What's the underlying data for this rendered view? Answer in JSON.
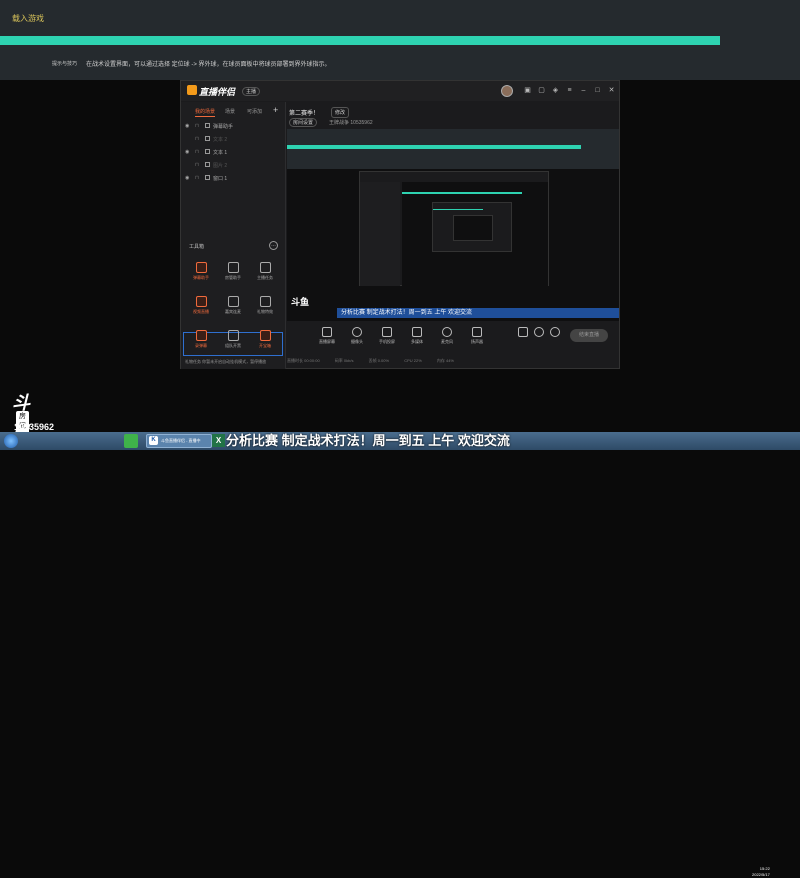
{
  "game": {
    "title": "载入游戏",
    "progress": 0.9,
    "tip_label": "提示与技巧",
    "tip_text": "在战术设置界面，可以通过选择 定位球 -> 界外球，在球员面板中将球员部署到界外球指示。"
  },
  "app": {
    "logo_text": "直播伴侣",
    "badge": "主播",
    "tabs": [
      "我的场景",
      "场景",
      "可添加"
    ],
    "sources": [
      {
        "name": "弹幕助手",
        "dim": false
      },
      {
        "name": "文本 2",
        "dim": true
      },
      {
        "name": "文本 1",
        "dim": false
      },
      {
        "name": "图片 2",
        "dim": true
      },
      {
        "name": "窗口 1",
        "dim": false
      }
    ],
    "tools_label": "工具箱",
    "tools": [
      {
        "label": "弹幕助手",
        "hot": true
      },
      {
        "label": "房管助手",
        "hot": false
      },
      {
        "label": "主播任务",
        "hot": false
      },
      {
        "label": "视频直播",
        "hot": true
      },
      {
        "label": "嘉宾连麦",
        "hot": false
      },
      {
        "label": "礼物特效",
        "hot": false
      },
      {
        "label": "录弹幕",
        "hot": true
      },
      {
        "label": "组队开黑",
        "hot": false
      },
      {
        "label": "开宝箱",
        "hot": true
      }
    ],
    "sidebar_footer": "礼物任务  你暂未开启自动挂机模式，暂停播放",
    "room_title": "第二赛季！",
    "room_tag": "修改",
    "room_button": "房间设置",
    "room_meta": "王牌战争  10535962",
    "overlay_logo": "斗鱼",
    "ticker": "分析比赛 制定战术打法！周一到五 上午 欢迎交流",
    "controls": [
      "直播屏幕",
      "摄像头",
      "手机投屏",
      "多媒体",
      "麦克风",
      "扬声器"
    ],
    "go_live": "结束直播",
    "status": [
      "直播时长 00:00:00",
      "码率 0kb/s",
      "丢帧 0.00%",
      "CPU 22%",
      "内存 44%"
    ]
  },
  "brand": {
    "logo": "斗鱼",
    "sub": "房间号",
    "room_id": "10535962"
  },
  "taskbar": {
    "task_item": "斗鱼直播伴侣 - 直播中",
    "big_ticker": "分析比赛 制定战术打法！周一到五 上午 欢迎交流",
    "time": "15:22",
    "date": "2022/5/17"
  }
}
